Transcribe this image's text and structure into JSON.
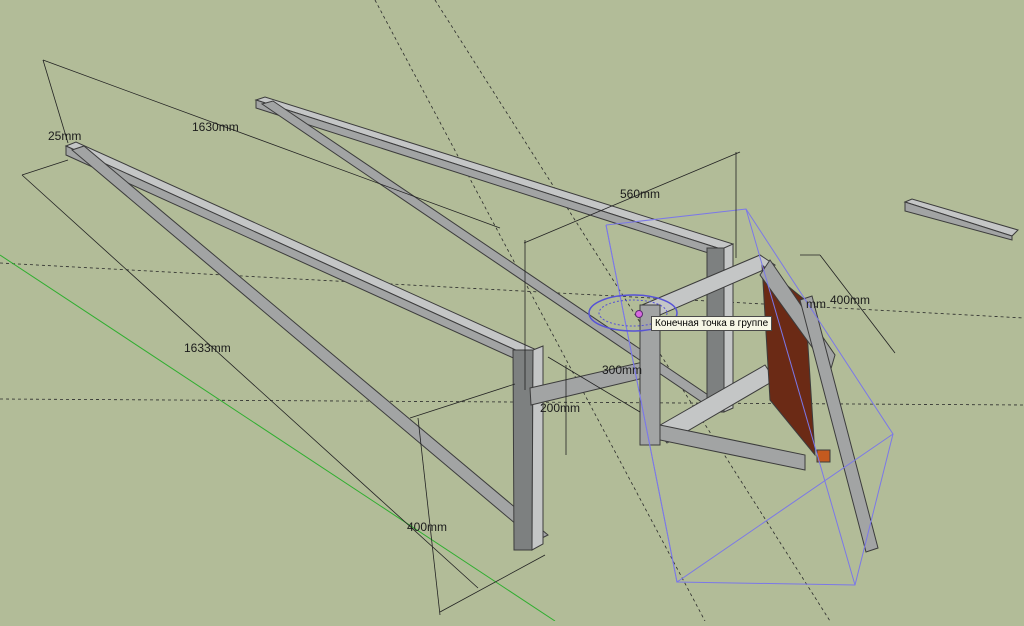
{
  "dimensions": {
    "d_top_left": "25mm",
    "d_long_top": "1630mm",
    "d_long_side": "1633mm",
    "d_width": "560mm",
    "d_frame_width": "400mm",
    "d_mid": "300mm",
    "d_height": "200mm",
    "d_bottom": "400mm",
    "d_partial": "mm"
  },
  "tooltip": {
    "text": "Конечная точка в группе"
  },
  "colors": {
    "background": "#b2bc98",
    "steel": "#a2a4a4",
    "selection": "#7b78e8",
    "green_axis": "#2fae2f",
    "plywood": "#6b2a15",
    "end_cap": "#c45a1f"
  }
}
